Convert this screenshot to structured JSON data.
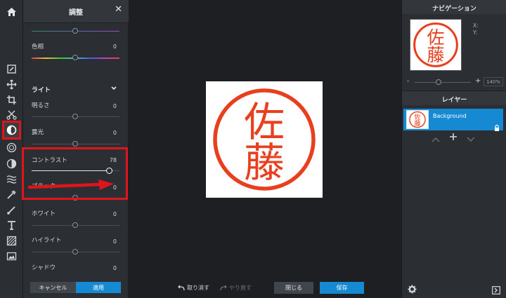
{
  "panel": {
    "title": "調整",
    "close_glyph": "✕",
    "top_slider_value": "",
    "hue": {
      "label": "色相",
      "value": "0"
    },
    "light_section": "ライト",
    "brightness": {
      "label": "明るさ",
      "value": "0"
    },
    "exposure": {
      "label": "露光",
      "value": "0"
    },
    "contrast": {
      "label": "コントラスト",
      "value": "78",
      "level_fraction": 0.88
    },
    "black": {
      "label": "ブラック",
      "value": "0"
    },
    "white": {
      "label": "ホワイト",
      "value": "0"
    },
    "highlight": {
      "label": "ハイライト",
      "value": "0"
    },
    "shadow": {
      "label": "シャドウ",
      "value": "0"
    },
    "cancel_label": "キャンセル",
    "apply_label": "適用"
  },
  "canvas": {
    "stamp_text_top": "佐",
    "stamp_text_bottom": "藤",
    "undo_label": "取り消す",
    "redo_label": "やり直す",
    "close_label": "閉じる",
    "save_label": "保存"
  },
  "navigation": {
    "title": "ナビゲーション",
    "x_label": "X:",
    "y_label": "Y:",
    "zoom_minus": "-",
    "zoom_plus": "+",
    "zoom_value": "140%"
  },
  "layers": {
    "title": "レイヤー",
    "items": [
      {
        "name": "Background"
      }
    ]
  },
  "colors": {
    "accent": "#1589d2",
    "highlight_red": "#e0141b",
    "stamp_red": "#e8401e"
  }
}
